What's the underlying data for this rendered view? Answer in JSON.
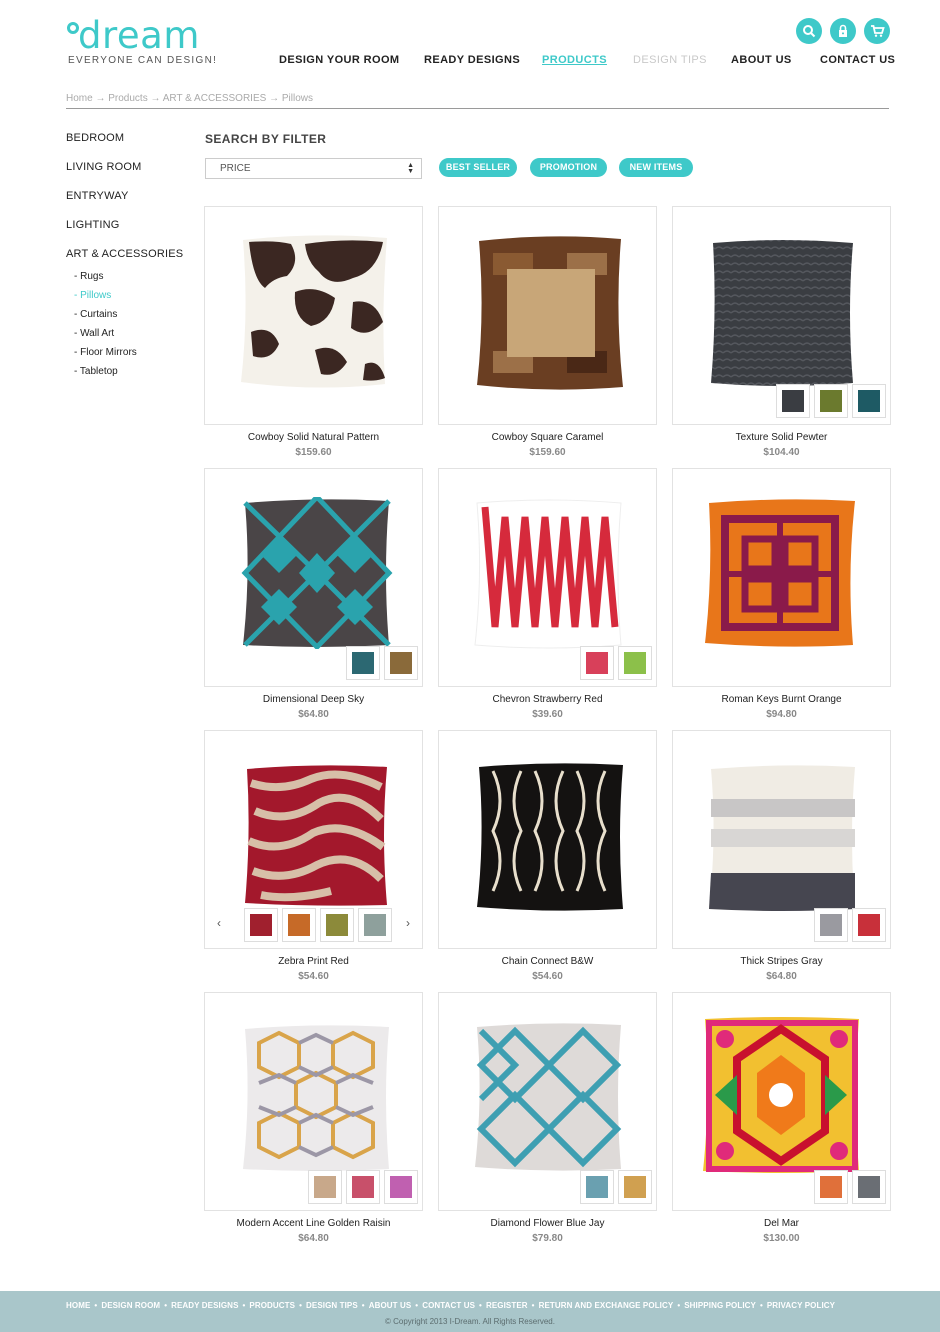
{
  "brand": {
    "name": "dream",
    "tagline": "EVERYONE CAN DESIGN!",
    "color": "#3ec9c9"
  },
  "header_icons": [
    "search-icon",
    "lock-icon",
    "cart-icon"
  ],
  "nav": [
    {
      "label": "DESIGN YOUR ROOM",
      "state": "normal"
    },
    {
      "label": "READY DESIGNS",
      "state": "normal"
    },
    {
      "label": "PRODUCTS",
      "state": "active"
    },
    {
      "label": "DESIGN TIPS",
      "state": "muted"
    },
    {
      "label": "ABOUT US",
      "state": "normal"
    },
    {
      "label": "CONTACT US",
      "state": "normal"
    }
  ],
  "breadcrumb": [
    "Home",
    "Products",
    "ART & ACCESSORIES",
    "Pillows"
  ],
  "sidebar": {
    "categories": [
      "BEDROOM",
      "LIVING ROOM",
      "ENTRYWAY",
      "LIGHTING",
      "ART & ACCESSORIES"
    ],
    "subcategories": [
      {
        "label": "- Rugs",
        "active": false
      },
      {
        "label": "- Pillows",
        "active": true
      },
      {
        "label": "- Curtains",
        "active": false
      },
      {
        "label": "- Wall Art",
        "active": false
      },
      {
        "label": "- Floor Mirrors",
        "active": false
      },
      {
        "label": "- Tabletop",
        "active": false
      }
    ]
  },
  "filter": {
    "title": "SEARCH BY FILTER",
    "price_label": "PRICE",
    "pills": [
      "BEST SELLER",
      "PROMOTION",
      "NEW ITEMS"
    ]
  },
  "products": [
    {
      "name": "Cowboy Solid Natural Pattern",
      "price": "$159.60",
      "swatches": []
    },
    {
      "name": "Cowboy Square Caramel",
      "price": "$159.60",
      "swatches": []
    },
    {
      "name": "Texture Solid Pewter",
      "price": "$104.40",
      "swatches": [
        "#3a3d42",
        "#6b7a2e",
        "#1e5a64"
      ]
    },
    {
      "name": "Dimensional Deep Sky",
      "price": "$64.80",
      "swatches": [
        "#2c6872",
        "#8a6a3a"
      ]
    },
    {
      "name": "Chevron Strawberry Red",
      "price": "$39.60",
      "swatches": [
        "#d8405a",
        "#8cc04a"
      ]
    },
    {
      "name": "Roman Keys Burnt Orange",
      "price": "$94.80",
      "swatches": []
    },
    {
      "name": "Zebra Print Red",
      "price": "$54.60",
      "swatches": [
        "#a0202e",
        "#c66a28",
        "#8c8a3a",
        "#8ea09c"
      ]
    },
    {
      "name": "Chain Connect B&W",
      "price": "$54.60",
      "swatches": []
    },
    {
      "name": "Thick Stripes Gray",
      "price": "$64.80",
      "swatches": [
        "#9a9aa0",
        "#c8303a"
      ]
    },
    {
      "name": "Modern Accent Line Golden Raisin",
      "price": "$64.80",
      "swatches": [
        "#c8a88a",
        "#c8506a",
        "#c060b0"
      ]
    },
    {
      "name": "Diamond Flower Blue Jay",
      "price": "$79.80",
      "swatches": [
        "#6aa0b0",
        "#d0a050"
      ]
    },
    {
      "name": "Del Mar",
      "price": "$130.00",
      "swatches": [
        "#e0703a",
        "#6a6e74"
      ]
    }
  ],
  "carousel_arrows": {
    "prev": "‹",
    "next": "›"
  },
  "footer": {
    "links": [
      "HOME",
      "DESIGN ROOM",
      "READY DESIGNS",
      "PRODUCTS",
      "DESIGN TIPS",
      "ABOUT US",
      "CONTACT US",
      "REGISTER",
      "RETURN AND EXCHANGE POLICY",
      "SHIPPING POLICY",
      "PRIVACY POLICY"
    ],
    "copyright": "© Copyright 2013 I-Dream. All Rights Reserved."
  }
}
